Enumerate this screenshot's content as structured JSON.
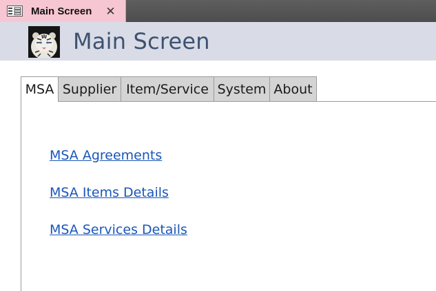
{
  "document_tab": {
    "title": "Main Screen",
    "icon": "form-icon",
    "close_icon": "close-icon",
    "background": "#f7c6d3"
  },
  "header": {
    "title": "Main Screen",
    "logo": "tiger-logo",
    "background": "#d9dce6",
    "title_color": "#3e5271"
  },
  "tabs": [
    {
      "label": "MSA",
      "active": true
    },
    {
      "label": "Supplier",
      "active": false
    },
    {
      "label": "Item/Service",
      "active": false
    },
    {
      "label": "System",
      "active": false
    },
    {
      "label": "About",
      "active": false
    }
  ],
  "msa_panel": {
    "links": [
      {
        "label": "MSA Agreements"
      },
      {
        "label": "MSA Items Details"
      },
      {
        "label": "MSA Services Details"
      }
    ],
    "link_color": "#1a56b8"
  }
}
